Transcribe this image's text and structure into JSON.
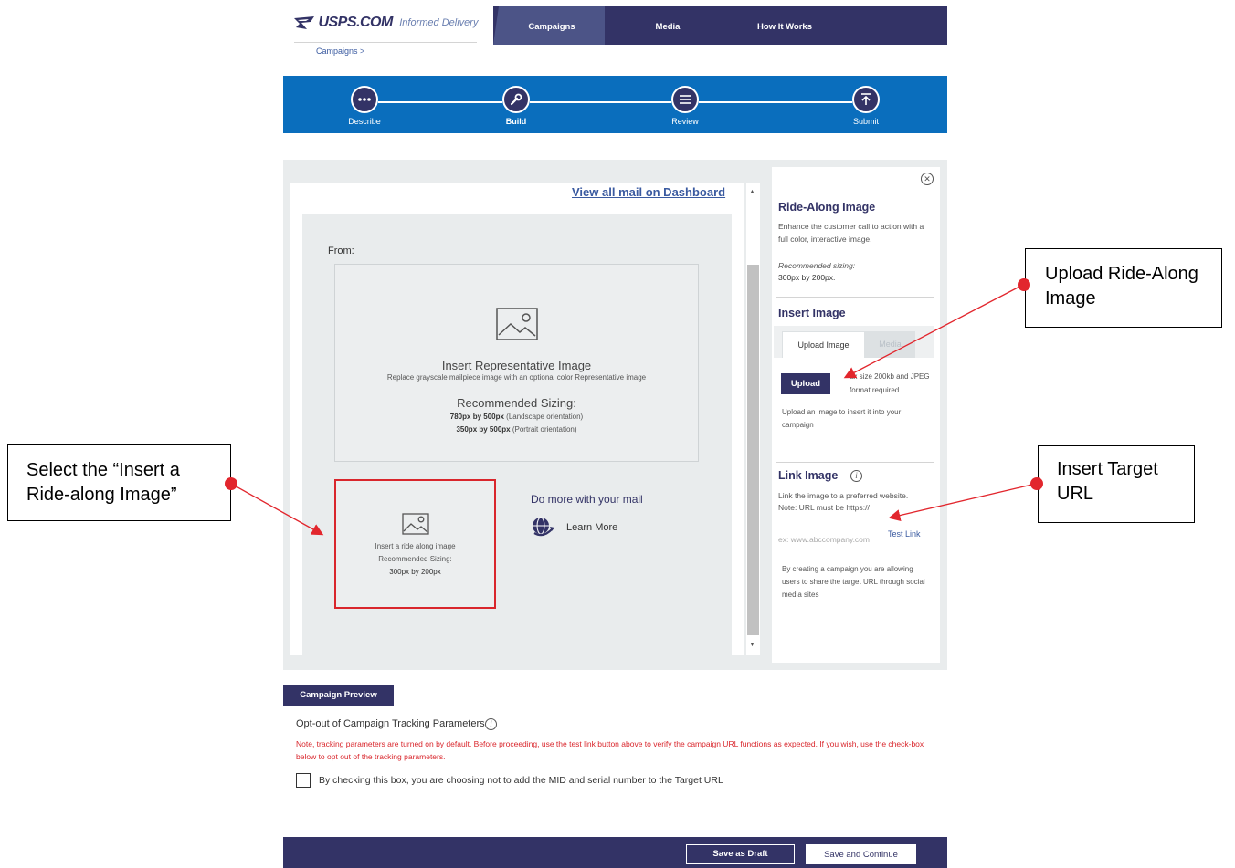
{
  "header": {
    "logo_text": "USPS.COM",
    "logo_sub": "Informed Delivery",
    "breadcrumb": "Campaigns >",
    "nav": [
      "Campaigns",
      "Media",
      "How It Works"
    ]
  },
  "progress": {
    "steps": [
      "Describe",
      "Build",
      "Review",
      "Submit"
    ]
  },
  "editor": {
    "dashboard_link": "View all mail on Dashboard",
    "from_label": "From:",
    "rep_title": "Insert Representative Image",
    "rep_desc": "Replace grayscale mailpiece image with an optional color Representative image",
    "rep_sizing_title": "Recommended Sizing:",
    "rep_size_landscape_bold": "780px by 500px",
    "rep_size_landscape_rest": " (Landscape orientation)",
    "rep_size_portrait_bold": "350px by 500px",
    "rep_size_portrait_rest": " (Portrait orientation)",
    "ride_line1": "Insert a ride along image",
    "ride_line2": "Recommended Sizing:",
    "ride_line3": "300px by 200px",
    "do_more": "Do more with your mail",
    "learn_more": "Learn More"
  },
  "panel": {
    "ride_heading": "Ride-Along Image",
    "ride_desc": "Enhance the customer call to action with a full color, interactive image.",
    "rec_label": "Recommended sizing:",
    "rec_value": "300px by 200px.",
    "insert_heading": "Insert Image",
    "tab_upload": "Upload Image",
    "tab_media": "Media",
    "upload_button": "Upload",
    "upload_req": "ax size 200kb and JPEG format required.",
    "upload_help": "Upload an image to insert it into your campaign",
    "link_heading": "Link Image",
    "link_desc": "Link the image to a preferred website.",
    "link_note": "Note: URL must be https://",
    "url_placeholder": "ex: www.abccompany.com",
    "test_link": "Test Link",
    "share_note": "By creating a campaign you are allowing users to share the target URL through social media sites"
  },
  "bottom": {
    "preview_button": "Campaign Preview",
    "optout_title": "Opt-out of Campaign Tracking Parameters",
    "optout_note": "Note, tracking parameters are turned on by default. Before proceeding, use the test link button above to verify the campaign URL functions as expected. If you wish, use the check-box below to opt out of the tracking parameters.",
    "checkbox_label": "By checking this box, you are choosing not to add the MID and serial number to the Target URL",
    "save_draft": "Save as Draft",
    "save_continue": "Save and Continue"
  },
  "annotations": {
    "upload_callout": "Upload Ride-Along Image",
    "select_callout": "Select the “Insert a Ride-along Image”",
    "url_callout": "Insert Target URL"
  },
  "colors": {
    "navy": "#333366",
    "blue": "#0a6ebd",
    "red": "#d9262c"
  }
}
